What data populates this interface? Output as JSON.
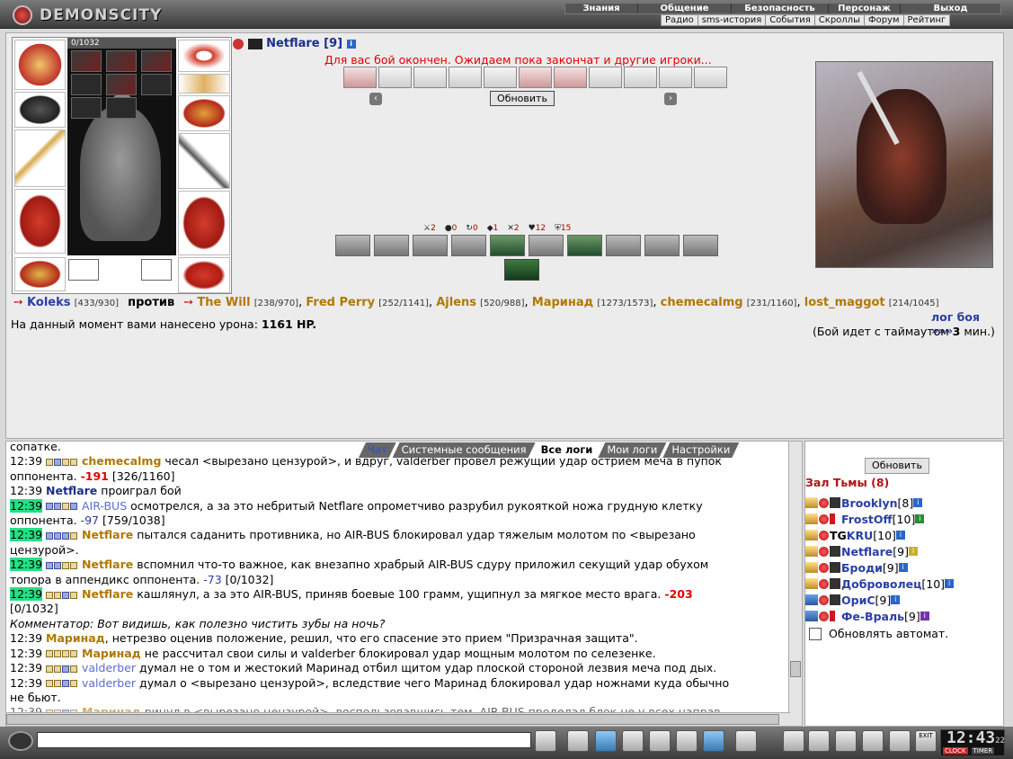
{
  "header": {
    "logo_text": "DEMONSCITY",
    "main_nav": [
      "Знания",
      "Общение",
      "Безопасность",
      "Персонаж",
      "Выход"
    ],
    "sub_nav": [
      "Радио",
      "sms-история",
      "События",
      "Скроллы",
      "Форум",
      "Рейтинг"
    ]
  },
  "player": {
    "hp": "0/1032",
    "name": "Netflare",
    "level": "[9]"
  },
  "fight": {
    "status_message": "Для вас бой окончен. Ожидаем пока закончат и другие игроки...",
    "refresh_label": "Обновить",
    "stats": [
      {
        "icon": "sword-icon",
        "value": "2"
      },
      {
        "icon": "blood-icon",
        "value": "0"
      },
      {
        "icon": "swap-icon",
        "value": "0"
      },
      {
        "icon": "shield-icon",
        "value": "1"
      },
      {
        "icon": "cross-swords-icon",
        "value": "2"
      },
      {
        "icon": "heart-icon",
        "value": "12"
      },
      {
        "icon": "armor-icon",
        "value": "15"
      }
    ],
    "team_a": [
      {
        "name": "Koleks",
        "hp": "[433/930]"
      }
    ],
    "versus_label": "против",
    "team_b": [
      {
        "name": "The Will",
        "hp": "[238/970]"
      },
      {
        "name": "Fred Perry",
        "hp": "[252/1141]"
      },
      {
        "name": "Ajlens",
        "hp": "[520/988]"
      },
      {
        "name": "Маринад",
        "hp": "[1273/1573]"
      },
      {
        "name": "chemecalmg",
        "hp": "[231/1160]"
      },
      {
        "name": "lost_maggot",
        "hp": "[214/1045]"
      }
    ],
    "log_link": "лог боя »»»",
    "damage_prefix": "На данный момент вами нанесено урона:",
    "damage_value": "1161 HP.",
    "timeout_prefix": "(Бой идет с таймаутом",
    "timeout_value": "3",
    "timeout_suffix": "мин.)"
  },
  "chat": {
    "tabs": [
      "Чат",
      "Системные сообщения",
      "Все логи",
      "Мои логи",
      "Настройки"
    ],
    "selected_tab": "Все логи",
    "lines": [
      {
        "time": "",
        "text": "сопатке."
      },
      {
        "time": "12:39",
        "actor": "chemecalmg",
        "text": "чесал <вырезано цензурой>, и вдруг, valderber провел режущий удар острием меча в пупок"
      },
      {
        "time": "",
        "text": "оппонента.",
        "dmg": "-191",
        "hp": "[326/1160]"
      },
      {
        "time": "12:39",
        "actor": "Netflare",
        "text": "проиграл бой"
      },
      {
        "time": "12:39",
        "actor": "AIR-BUS",
        "text": "осмотрелся, а за это небритый Netflare опрометчиво разрубил рукояткой ножа грудную клетку"
      },
      {
        "time": "",
        "text": "оппонента.",
        "dmg": "-97",
        "hp": "[759/1038]"
      },
      {
        "time": "12:39",
        "actor": "Netflare",
        "text": "пытался саданить противника, но AIR-BUS блокировал удар тяжелым молотом по <вырезано"
      },
      {
        "time": "",
        "text": "цензурой>."
      },
      {
        "time": "12:39",
        "actor": "Netflare",
        "text": "вспомнил что-то важное, как внезапно храбрый AIR-BUS сдуру приложил секущий удар обухом"
      },
      {
        "time": "",
        "text": "топора в аппендикс оппонента.",
        "dmg": "-73",
        "hp": "[0/1032]"
      },
      {
        "time": "12:39",
        "actor": "Netflare",
        "text": "кашлянул, а за это AIR-BUS, приняв боевые 100 грамм, ущипнул за мягкое место врага.",
        "dmg": "-203"
      },
      {
        "time": "",
        "text": "[0/1032]"
      },
      {
        "time": "",
        "text": "Комментатор: Вот видишь, как полезно чистить зубы на ночь?"
      },
      {
        "time": "12:39",
        "actor": "Маринад",
        "text": ", нетрезво оценив положение, решил, что его спасение это прием \"Призрачная защита\"."
      },
      {
        "time": "12:39",
        "actor": "Маринад",
        "text": "не рассчитал свои силы и valderber блокировал удар мощным молотом по селезенке."
      },
      {
        "time": "12:39",
        "actor": "valderber",
        "text": "думал не о том и жестокий Маринад отбил щитом удар плоской стороной лезвия меча под дых."
      },
      {
        "time": "12:39",
        "actor": "valderber",
        "text": "думал о <вырезано цензурой>, вследствие чего Маринад блокировал удар ножнами куда обычно"
      },
      {
        "time": "",
        "text": "не бьют."
      },
      {
        "time": "12:39",
        "actor": "Маринад",
        "text": "ринул в <вырезано цензурой>, воспользовавшись тем, AIR-BUS проделал блок не у всех направ-"
      }
    ]
  },
  "room": {
    "refresh_label": "Обновить",
    "title": "Зал Тьмы (8)",
    "players": [
      {
        "name": "Brooklyn",
        "level": "[8]",
        "info": "blue"
      },
      {
        "name": "FrostOff",
        "level": "[10]",
        "info": "green"
      },
      {
        "name": "KRU",
        "level": "[10]",
        "info": "blue",
        "clan": "TG"
      },
      {
        "name": "Netflare",
        "level": "[9]",
        "info": "yellow"
      },
      {
        "name": "Броди",
        "level": "[9]",
        "info": "blue"
      },
      {
        "name": "Доброволец",
        "level": "[10]",
        "info": "blue"
      },
      {
        "name": "ОриС",
        "level": "[9]",
        "info": "blue"
      },
      {
        "name": "Фе-Враль",
        "level": "[9]",
        "info": "purple"
      }
    ],
    "auto_update_label": "Обновлять автомат."
  },
  "bottom": {
    "clock_time": "12:43",
    "clock_seconds": "22",
    "clock_label": "CLOCK",
    "timer_label": "TIMER",
    "exit_label": "EXIT"
  }
}
